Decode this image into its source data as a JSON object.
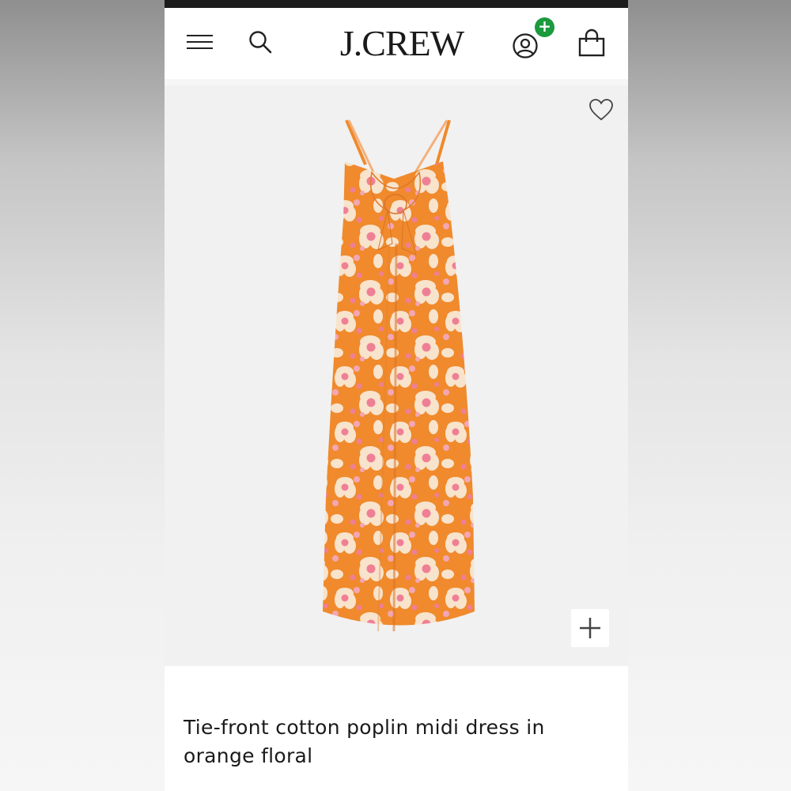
{
  "header": {
    "logo_text": "J.CREW",
    "menu_icon": "hamburger-menu-icon",
    "search_icon": "search-icon",
    "account_icon": "account-icon",
    "account_badge": "+",
    "bag_icon": "shopping-bag-icon"
  },
  "product": {
    "title_line1": "Tie-front cotton poplin midi dress in",
    "title_line2": "orange floral",
    "wishlist_icon": "heart-icon",
    "zoom_icon": "plus-icon"
  },
  "colors": {
    "status_bar": "#1c1c1c",
    "badge_green": "#1b9a3e",
    "image_bg": "#f1f1f1",
    "dress_orange": "#f08a2c",
    "flower_cream": "#f8e3cc",
    "flower_pink": "#ef7f95"
  }
}
